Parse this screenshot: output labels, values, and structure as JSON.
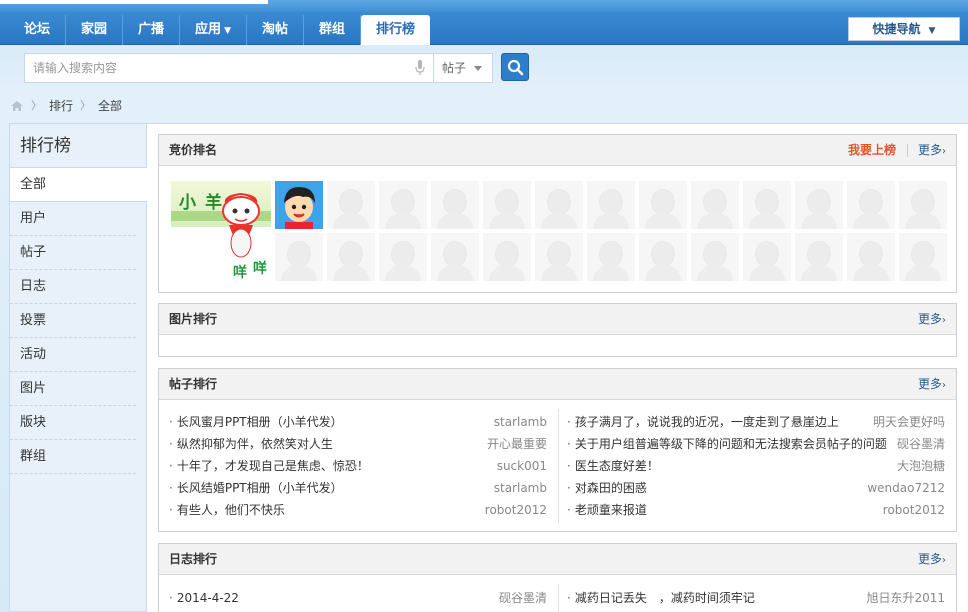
{
  "nav": {
    "tabs": [
      {
        "label": "论坛"
      },
      {
        "label": "家园"
      },
      {
        "label": "广播"
      },
      {
        "label": "应用"
      },
      {
        "label": "淘帖"
      },
      {
        "label": "群组"
      },
      {
        "label": "排行榜"
      }
    ],
    "quick_nav": "快捷导航"
  },
  "search": {
    "placeholder": "请输入搜索内容",
    "type": "帖子"
  },
  "breadcrumb": [
    "排行",
    "全部"
  ],
  "sidebar": {
    "title": "排行榜",
    "items": [
      "全部",
      "用户",
      "帖子",
      "日志",
      "投票",
      "活动",
      "图片",
      "版块",
      "群组"
    ],
    "active": "全部"
  },
  "bid": {
    "title": "竞价排名",
    "action": "我要上榜",
    "more": "更多",
    "featured_text": "小羊 咩咩"
  },
  "pics": {
    "title": "图片排行",
    "more": "更多"
  },
  "threads": {
    "title": "帖子排行",
    "more": "更多",
    "left": [
      {
        "title": "长风蜜月PPT相册（小羊代发）",
        "user": "starlamb"
      },
      {
        "title": "纵然抑郁为伴，依然笑对人生",
        "user": "开心最重要"
      },
      {
        "title": "十年了，才发现自己是焦虑、惊恐！",
        "user": "suck001"
      },
      {
        "title": "长风结婚PPT相册（小羊代发）",
        "user": "starlamb"
      },
      {
        "title": "有些人，他们不快乐",
        "user": "robot2012"
      }
    ],
    "right": [
      {
        "title": "孩子满月了，说说我的近况，一度走到了悬崖边上",
        "user": "明天会更好吗"
      },
      {
        "title": "关于用户组普遍等级下降的问题和无法搜索会员帖子的问题",
        "user": "砚谷墨清"
      },
      {
        "title": "医生态度好差！",
        "user": "大泡泡糖"
      },
      {
        "title": "对森田的困惑",
        "user": "wendao7212"
      },
      {
        "title": "老顽童来报道",
        "user": "robot2012"
      }
    ]
  },
  "blogs": {
    "title": "日志排行",
    "more": "更多",
    "left": [
      {
        "title": "2014-4-22",
        "user": "砚谷墨清"
      }
    ],
    "right": [
      {
        "title": "减药日记丢失　，减药时间须牢记",
        "user": "旭日东升2011"
      }
    ]
  },
  "colors": {
    "nav": "#2a76c2",
    "accent": "#e0562b",
    "link": "#2a5a8c"
  }
}
